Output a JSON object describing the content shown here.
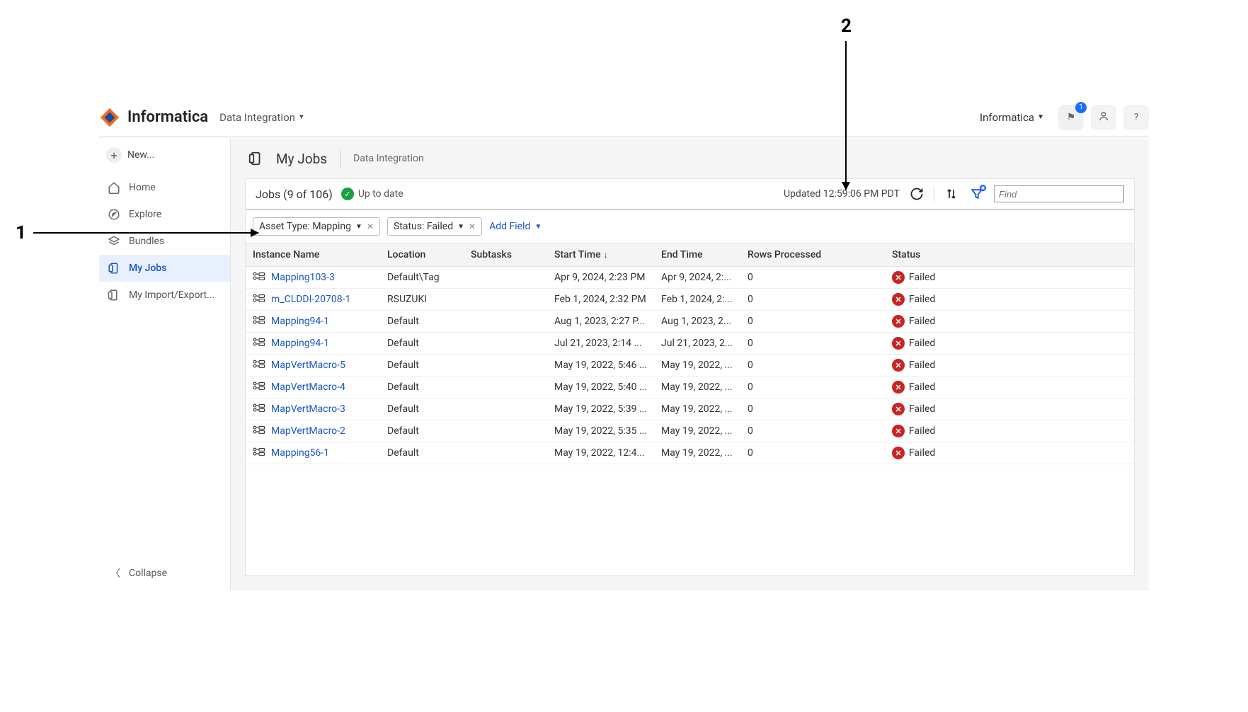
{
  "header": {
    "brand": "Informatica",
    "product": "Data Integration",
    "org": "Informatica",
    "notif_count": "1"
  },
  "sidebar": {
    "new_label": "New...",
    "items": [
      {
        "label": "Home"
      },
      {
        "label": "Explore"
      },
      {
        "label": "Bundles"
      },
      {
        "label": "My Jobs"
      },
      {
        "label": "My Import/Export..."
      }
    ],
    "collapse_label": "Collapse"
  },
  "page": {
    "title": "My Jobs",
    "breadcrumb": "Data Integration"
  },
  "toolbar": {
    "jobs_label": "Jobs (9 of 106)",
    "uptodate_label": "Up to date",
    "updated_label": "Updated 12:59:06 PM PDT",
    "find_placeholder": "Find"
  },
  "filters": {
    "chips": [
      {
        "label": "Asset Type: Mapping"
      },
      {
        "label": "Status: Failed"
      }
    ],
    "add_field_label": "Add Field"
  },
  "columns": {
    "instance": "Instance Name",
    "location": "Location",
    "subtasks": "Subtasks",
    "start": "Start Time",
    "end": "End Time",
    "rows": "Rows Processed",
    "status": "Status"
  },
  "rows": [
    {
      "instance": "Mapping103-3",
      "location": "Default\\Tag",
      "subtasks": "",
      "start": "Apr 9, 2024, 2:23 PM",
      "end": "Apr 9, 2024, 2:...",
      "rows": "0",
      "status": "Failed"
    },
    {
      "instance": "m_CLDDI-20708-1",
      "location": "RSUZUKI",
      "subtasks": "",
      "start": "Feb 1, 2024, 2:32 PM",
      "end": "Feb 1, 2024, 2:...",
      "rows": "0",
      "status": "Failed"
    },
    {
      "instance": "Mapping94-1",
      "location": "Default",
      "subtasks": "",
      "start": "Aug 1, 2023, 2:27 P...",
      "end": "Aug 1, 2023, 2...",
      "rows": "0",
      "status": "Failed"
    },
    {
      "instance": "Mapping94-1",
      "location": "Default",
      "subtasks": "",
      "start": "Jul 21, 2023, 2:14 ...",
      "end": "Jul 21, 2023, 2...",
      "rows": "0",
      "status": "Failed"
    },
    {
      "instance": "MapVertMacro-5",
      "location": "Default",
      "subtasks": "",
      "start": "May 19, 2022, 5:46 ...",
      "end": "May 19, 2022, ...",
      "rows": "0",
      "status": "Failed"
    },
    {
      "instance": "MapVertMacro-4",
      "location": "Default",
      "subtasks": "",
      "start": "May 19, 2022, 5:40 ...",
      "end": "May 19, 2022, ...",
      "rows": "0",
      "status": "Failed"
    },
    {
      "instance": "MapVertMacro-3",
      "location": "Default",
      "subtasks": "",
      "start": "May 19, 2022, 5:39 ...",
      "end": "May 19, 2022, ...",
      "rows": "0",
      "status": "Failed"
    },
    {
      "instance": "MapVertMacro-2",
      "location": "Default",
      "subtasks": "",
      "start": "May 19, 2022, 5:35 ...",
      "end": "May 19, 2022, ...",
      "rows": "0",
      "status": "Failed"
    },
    {
      "instance": "Mapping56-1",
      "location": "Default",
      "subtasks": "",
      "start": "May 19, 2022, 12:4...",
      "end": "May 19, 2022, ...",
      "rows": "0",
      "status": "Failed"
    }
  ],
  "callouts": {
    "one": "1",
    "two": "2"
  }
}
